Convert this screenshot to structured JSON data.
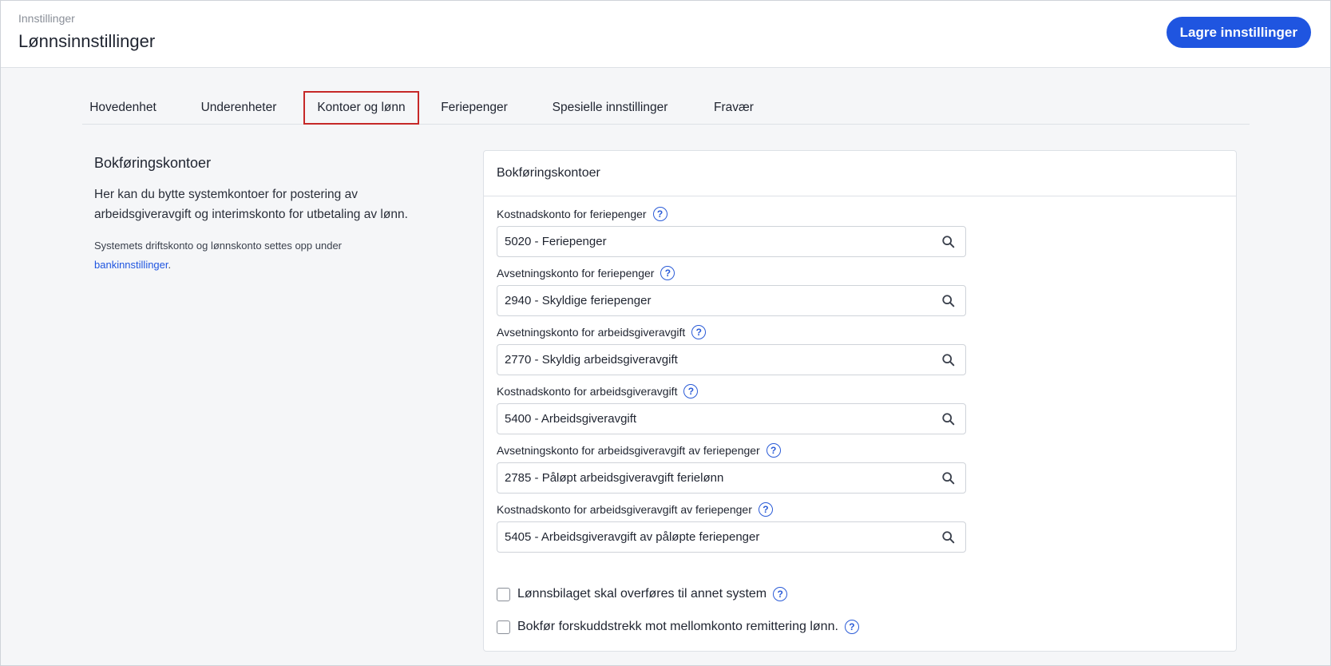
{
  "header": {
    "breadcrumb": "Innstillinger",
    "title": "Lønnsinnstillinger",
    "save_label": "Lagre innstillinger"
  },
  "tabs": [
    {
      "label": "Hovedenhet",
      "active": false
    },
    {
      "label": "Underenheter",
      "active": false
    },
    {
      "label": "Kontoer og lønn",
      "active": true
    },
    {
      "label": "Feriepenger",
      "active": false
    },
    {
      "label": "Spesielle innstillinger",
      "active": false
    },
    {
      "label": "Fravær",
      "active": false
    }
  ],
  "side": {
    "title": "Bokføringskontoer",
    "description": "Her kan du bytte systemkontoer for postering av arbeidsgiveravgift og interimskonto for utbetaling av lønn.",
    "note_prefix": "Systemets driftskonto og lønnskonto settes opp under",
    "note_link": "bankinnstillinger",
    "note_suffix": "."
  },
  "card": {
    "title": "Bokføringskontoer",
    "fields": [
      {
        "label": "Kostnadskonto for feriepenger",
        "value": "5020 - Feriepenger"
      },
      {
        "label": "Avsetningskonto for feriepenger",
        "value": "2940 - Skyldige feriepenger"
      },
      {
        "label": "Avsetningskonto for arbeidsgiveravgift",
        "value": "2770 - Skyldig arbeidsgiveravgift"
      },
      {
        "label": "Kostnadskonto for arbeidsgiveravgift",
        "value": "5400 - Arbeidsgiveravgift"
      },
      {
        "label": "Avsetningskonto for arbeidsgiveravgift av feriepenger",
        "value": "2785 - Påløpt arbeidsgiveravgift ferielønn"
      },
      {
        "label": "Kostnadskonto for arbeidsgiveravgift av feriepenger",
        "value": "5405 - Arbeidsgiveravgift av påløpte feriepenger"
      }
    ],
    "checkboxes": [
      {
        "label": "Lønnsbilaget skal overføres til annet system",
        "checked": false
      },
      {
        "label": "Bokfør forskuddstrekk mot mellomkonto remittering lønn.",
        "checked": false
      }
    ]
  },
  "icons": {
    "help": "help-circle-icon",
    "search": "search-icon"
  },
  "colors": {
    "accent": "#1f55e0",
    "active_tab_outline": "#c62828"
  }
}
